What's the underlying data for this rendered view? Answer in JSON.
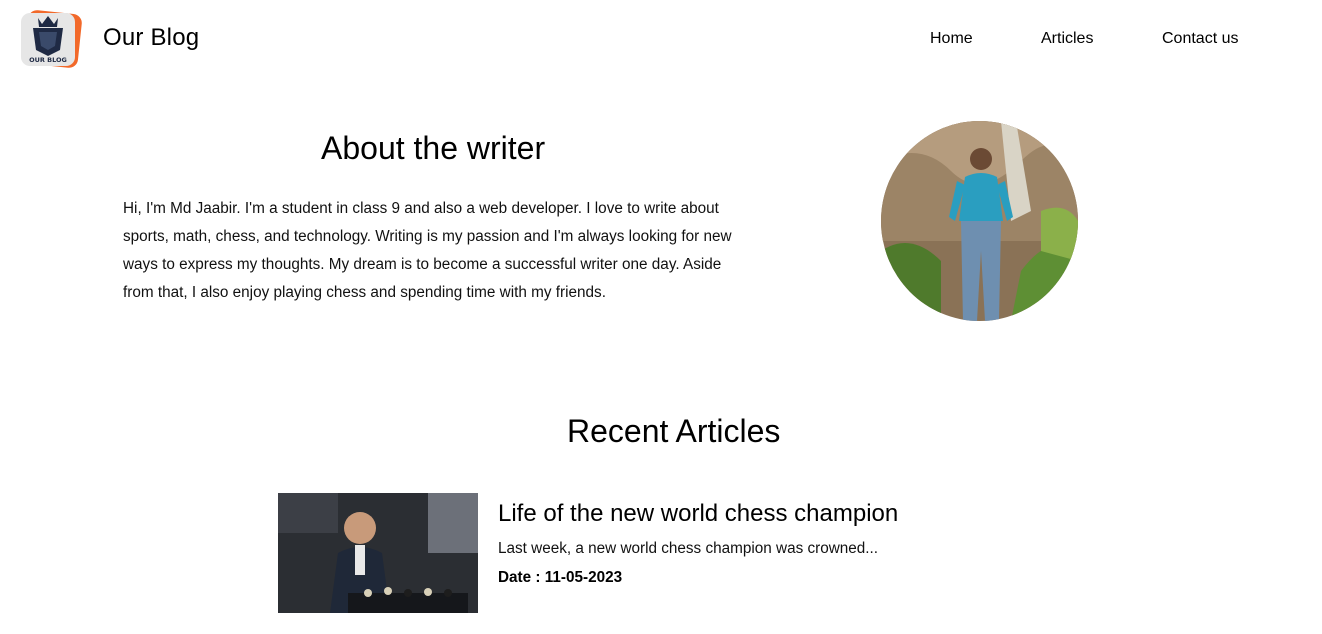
{
  "header": {
    "logo_text": "OUR BLOG",
    "brand": "Our Blog",
    "nav": [
      {
        "label": "Home"
      },
      {
        "label": "Articles"
      },
      {
        "label": "Contact us"
      }
    ]
  },
  "about": {
    "title": "About the writer",
    "text": "Hi, I'm Md Jaabir. I'm a student in class 9 and also a web developer. I love to write about sports, math, chess, and technology. Writing is my passion and I'm always looking for new ways to express my thoughts. My dream is to become a successful writer one day. Aside from that, I also enjoy playing chess and spending time with my friends."
  },
  "recent": {
    "title": "Recent Articles",
    "articles": [
      {
        "title": "Life of the new world chess champion",
        "excerpt": "Last week, a new world chess champion was crowned...",
        "date": "Date : 11-05-2023"
      }
    ]
  }
}
